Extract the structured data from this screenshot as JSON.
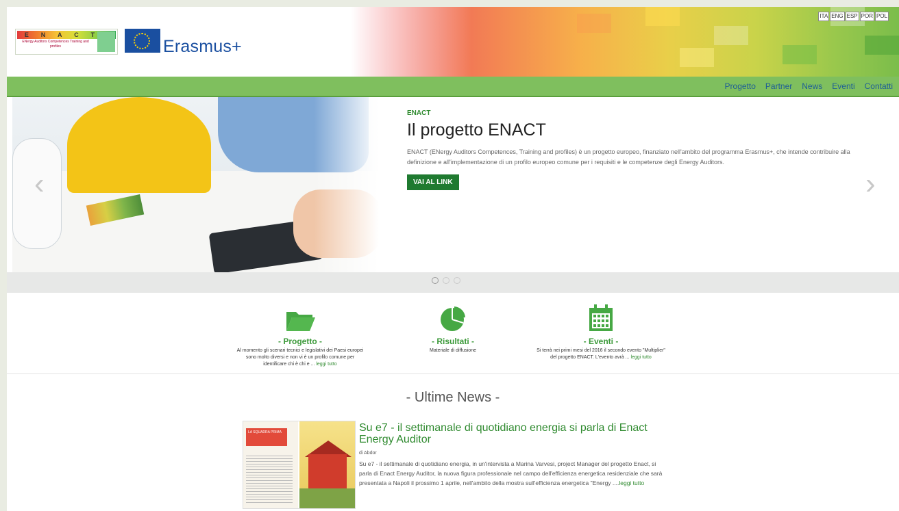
{
  "header": {
    "logo_enact_letters": [
      "E",
      "N",
      "A",
      "C",
      "T"
    ],
    "logo_enact_subtitle": "ENergy Auditors Competences Training and profiles",
    "erasmus_label": "Erasmus+",
    "languages": [
      "ITA",
      "ENG",
      "ESP",
      "POR",
      "POL"
    ]
  },
  "nav": {
    "items": [
      "Progetto",
      "Partner",
      "News",
      "Eventi",
      "Contatti"
    ]
  },
  "slider": {
    "kicker": "ENACT",
    "title": "Il progetto ENACT",
    "description": "ENACT (ENergy Auditors Competences, Training and profiles) è un progetto europeo, finanziato nell'ambito del programma Erasmus+, che intende contribuire alla definizione e all'implementazione di un profilo europeo comune per i requisiti e le competenze degli Energy Auditors.",
    "button_label": "VAI AL LINK",
    "prev_arrow": "‹",
    "next_arrow": "›",
    "dots": 3,
    "active_dot": 0
  },
  "features": [
    {
      "icon": "folder-icon",
      "title": "- Progetto -",
      "text": "Al momento gli scenari tecnici e legislativi dei Paesi europei sono molto diversi e non vi è un profilo comune per identificare chi è chi e ...",
      "more": "leggi tutto"
    },
    {
      "icon": "pie-chart-icon",
      "title": "- Risultati -",
      "text": "Materiale di diffusione",
      "more": ""
    },
    {
      "icon": "calendar-icon",
      "title": "- Eventi -",
      "text": "Si terrà nei primi mesi del 2016 il secondo evento \"Multiplier\" del progetto ENACT. L'evento avrà ...",
      "more": "leggi tutto"
    }
  ],
  "news": {
    "heading": "- Ultime News -",
    "item": {
      "title": "Su e7 - il settimanale di quotidiano energia si parla di Enact Energy Auditor",
      "author": "di Abdor",
      "excerpt": "Su e7 - il settimanale di quotidiano energia, in un'intervista a Marina Varvesi, project Manager del progetto Enact, si parla di Enact Energy Auditor, la nuova figura professionale nel campo dell'efficienza energetica residenziale che sarà presentata a Napoli il prossimo 1 aprile, nell'ambito della mostra sull'efficienza energetica \"Energy ....",
      "more": "leggi tutto",
      "thumb_caption": "LA SQUADRA PRIMA"
    }
  },
  "colors": {
    "nav_green": "#7fbf5e",
    "accent_green": "#3c9a3a",
    "button_green": "#1f7a30",
    "link_blue": "#1e5e96",
    "erasmus_blue": "#1a4fa0"
  }
}
